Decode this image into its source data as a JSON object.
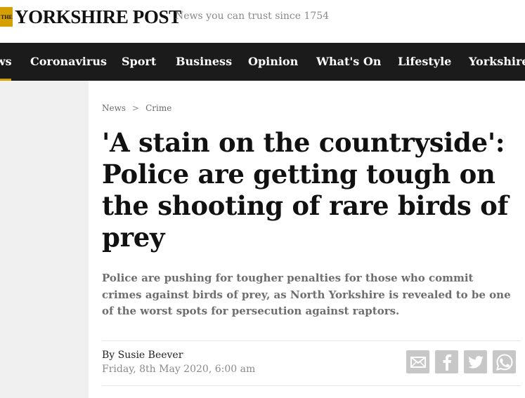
{
  "header": {
    "logo_the": "THE",
    "logo_name": "YORKSHIRE POST",
    "tagline": "News you can trust since 1754"
  },
  "nav": {
    "items": [
      {
        "label": "News"
      },
      {
        "label": "Coronavirus"
      },
      {
        "label": "Sport"
      },
      {
        "label": "Business"
      },
      {
        "label": "Opinion"
      },
      {
        "label": "What's On"
      },
      {
        "label": "Lifestyle"
      },
      {
        "label": "Yorkshire"
      }
    ],
    "active_index": 0
  },
  "article": {
    "breadcrumb": [
      "News",
      "Crime"
    ],
    "breadcrumb_separator": ">",
    "headline": "'A stain on the countryside': Police are getting tough on the shooting of rare birds of prey",
    "standfirst": "Police are pushing for tougher penalties for those who commit crimes against birds of prey, as North Yorkshire is revealed to be one of the worst spots for persecution against raptors.",
    "byline": "By Susie Beever",
    "date": "Friday, 8th May 2020, 6:00 am"
  },
  "share": {
    "icons": [
      "email-icon",
      "facebook-icon",
      "twitter-icon",
      "whatsapp-icon"
    ]
  },
  "colors": {
    "nav_background": "#1b1b1b",
    "accent": "#d4a100",
    "page_background": "#f0f0f0",
    "share_icon_background": "#c7c7c7"
  }
}
